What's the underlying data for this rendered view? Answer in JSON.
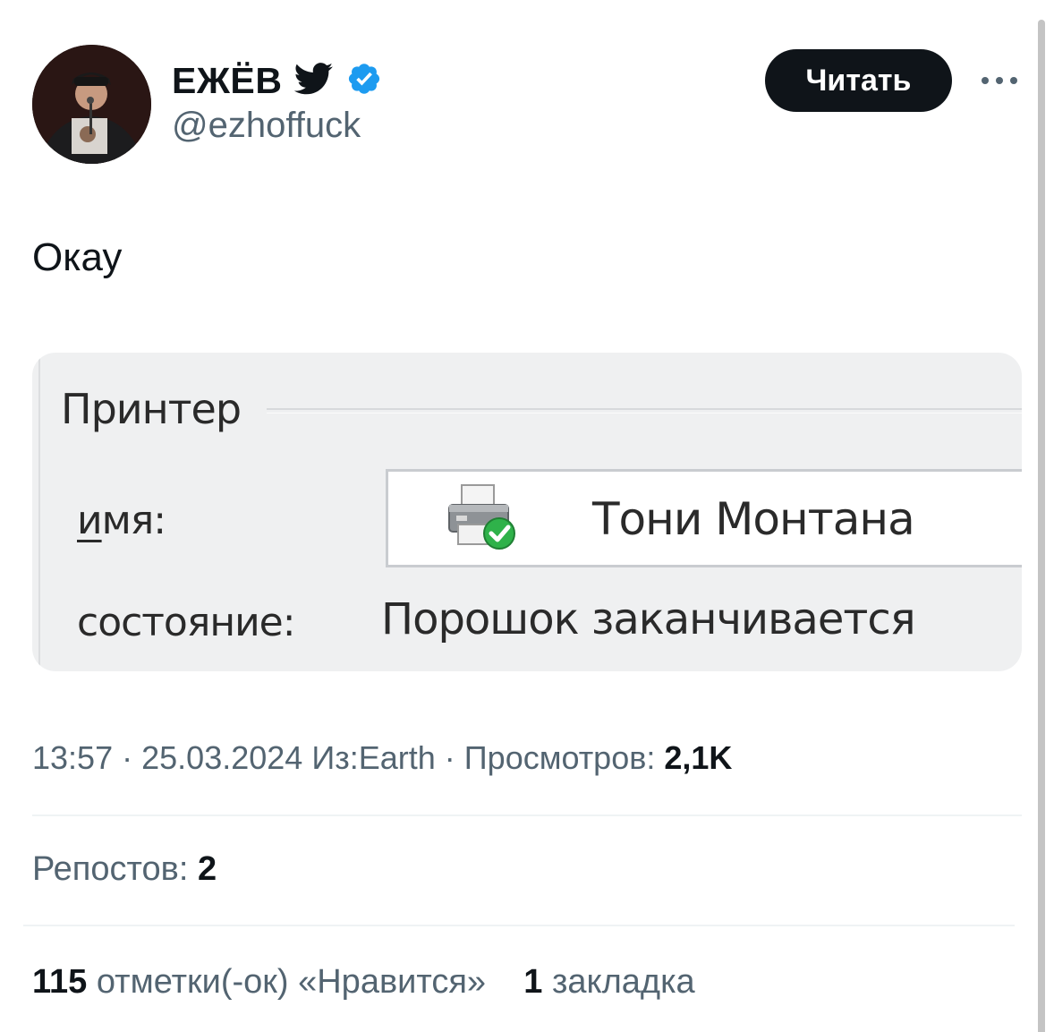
{
  "author": {
    "display_name": "ЕЖЁВ",
    "handle": "@ezhoffuck",
    "follow_label": "Читать",
    "icons": [
      "bird-icon",
      "verified-badge-icon",
      "more-icon"
    ],
    "verified_color": "#1d9bf0"
  },
  "tweet": {
    "text": "Окау"
  },
  "media": {
    "group_label": "Принтер",
    "name_label_underlined": "и",
    "name_label_rest": "мя:",
    "printer_name": "Тони Монтана",
    "state_label": "состояние:",
    "state_value": "Порошок заканчивается",
    "status_color": "#2fb24a"
  },
  "meta": {
    "time": "13:57",
    "sep": "·",
    "date": "25.03.2024",
    "source": "Из:Earth",
    "views_label": "Просмотров:",
    "views_value": "2,1K"
  },
  "stats": {
    "reposts_label": "Репостов:",
    "reposts_value": "2",
    "likes_value": "115",
    "likes_label": "отметки(-ок) «Нравится»",
    "bookmarks_value": "1",
    "bookmarks_label": "закладка"
  }
}
